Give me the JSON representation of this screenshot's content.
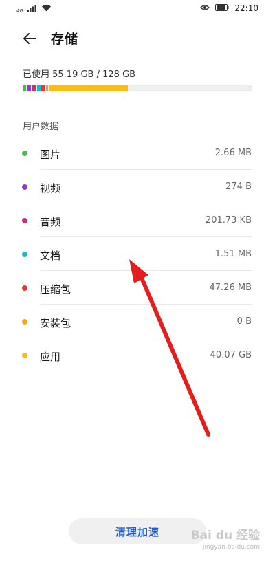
{
  "status_bar": {
    "network": "4G",
    "time": "22:10",
    "icons": [
      "signal-icon",
      "wifi-icon",
      "eye-icon",
      "battery-icon"
    ]
  },
  "header": {
    "title": "存储",
    "back_icon": "back-arrow-icon"
  },
  "usage": {
    "text": "已使用 55.19 GB / 128 GB",
    "used_fraction": 0.431,
    "segments": [
      {
        "name": "图片",
        "color": "#4cb84c",
        "share": 0.016
      },
      {
        "name": "视频",
        "color": "#8a3ccf",
        "share": 0.016
      },
      {
        "name": "音频",
        "color": "#d1287a",
        "share": 0.016
      },
      {
        "name": "文档",
        "color": "#22b8c8",
        "share": 0.016
      },
      {
        "name": "压缩包",
        "color": "#e53935",
        "share": 0.016
      },
      {
        "name": "安装包",
        "color": "#f5a623",
        "share": 0.008
      },
      {
        "name": "应用",
        "color": "#f7bd19",
        "share": 0.343
      }
    ]
  },
  "section": {
    "title": "用户数据"
  },
  "items": [
    {
      "label": "图片",
      "value": "2.66 MB",
      "color": "#4cb84c"
    },
    {
      "label": "视频",
      "value": "274 B",
      "color": "#8a3ccf"
    },
    {
      "label": "音频",
      "value": "201.73 KB",
      "color": "#d1287a"
    },
    {
      "label": "文档",
      "value": "1.51 MB",
      "color": "#22b8c8"
    },
    {
      "label": "压缩包",
      "value": "47.26 MB",
      "color": "#e53935"
    },
    {
      "label": "安装包",
      "value": "0 B",
      "color": "#f5a623"
    },
    {
      "label": "应用",
      "value": "40.07 GB",
      "color": "#f7bd19"
    }
  ],
  "actions": {
    "clean_label": "清理加速"
  },
  "watermark": {
    "brand": "Bai du 经验",
    "url": "jingyan.baidu.com"
  },
  "annotation": {
    "arrow_color": "#e51d1d"
  }
}
